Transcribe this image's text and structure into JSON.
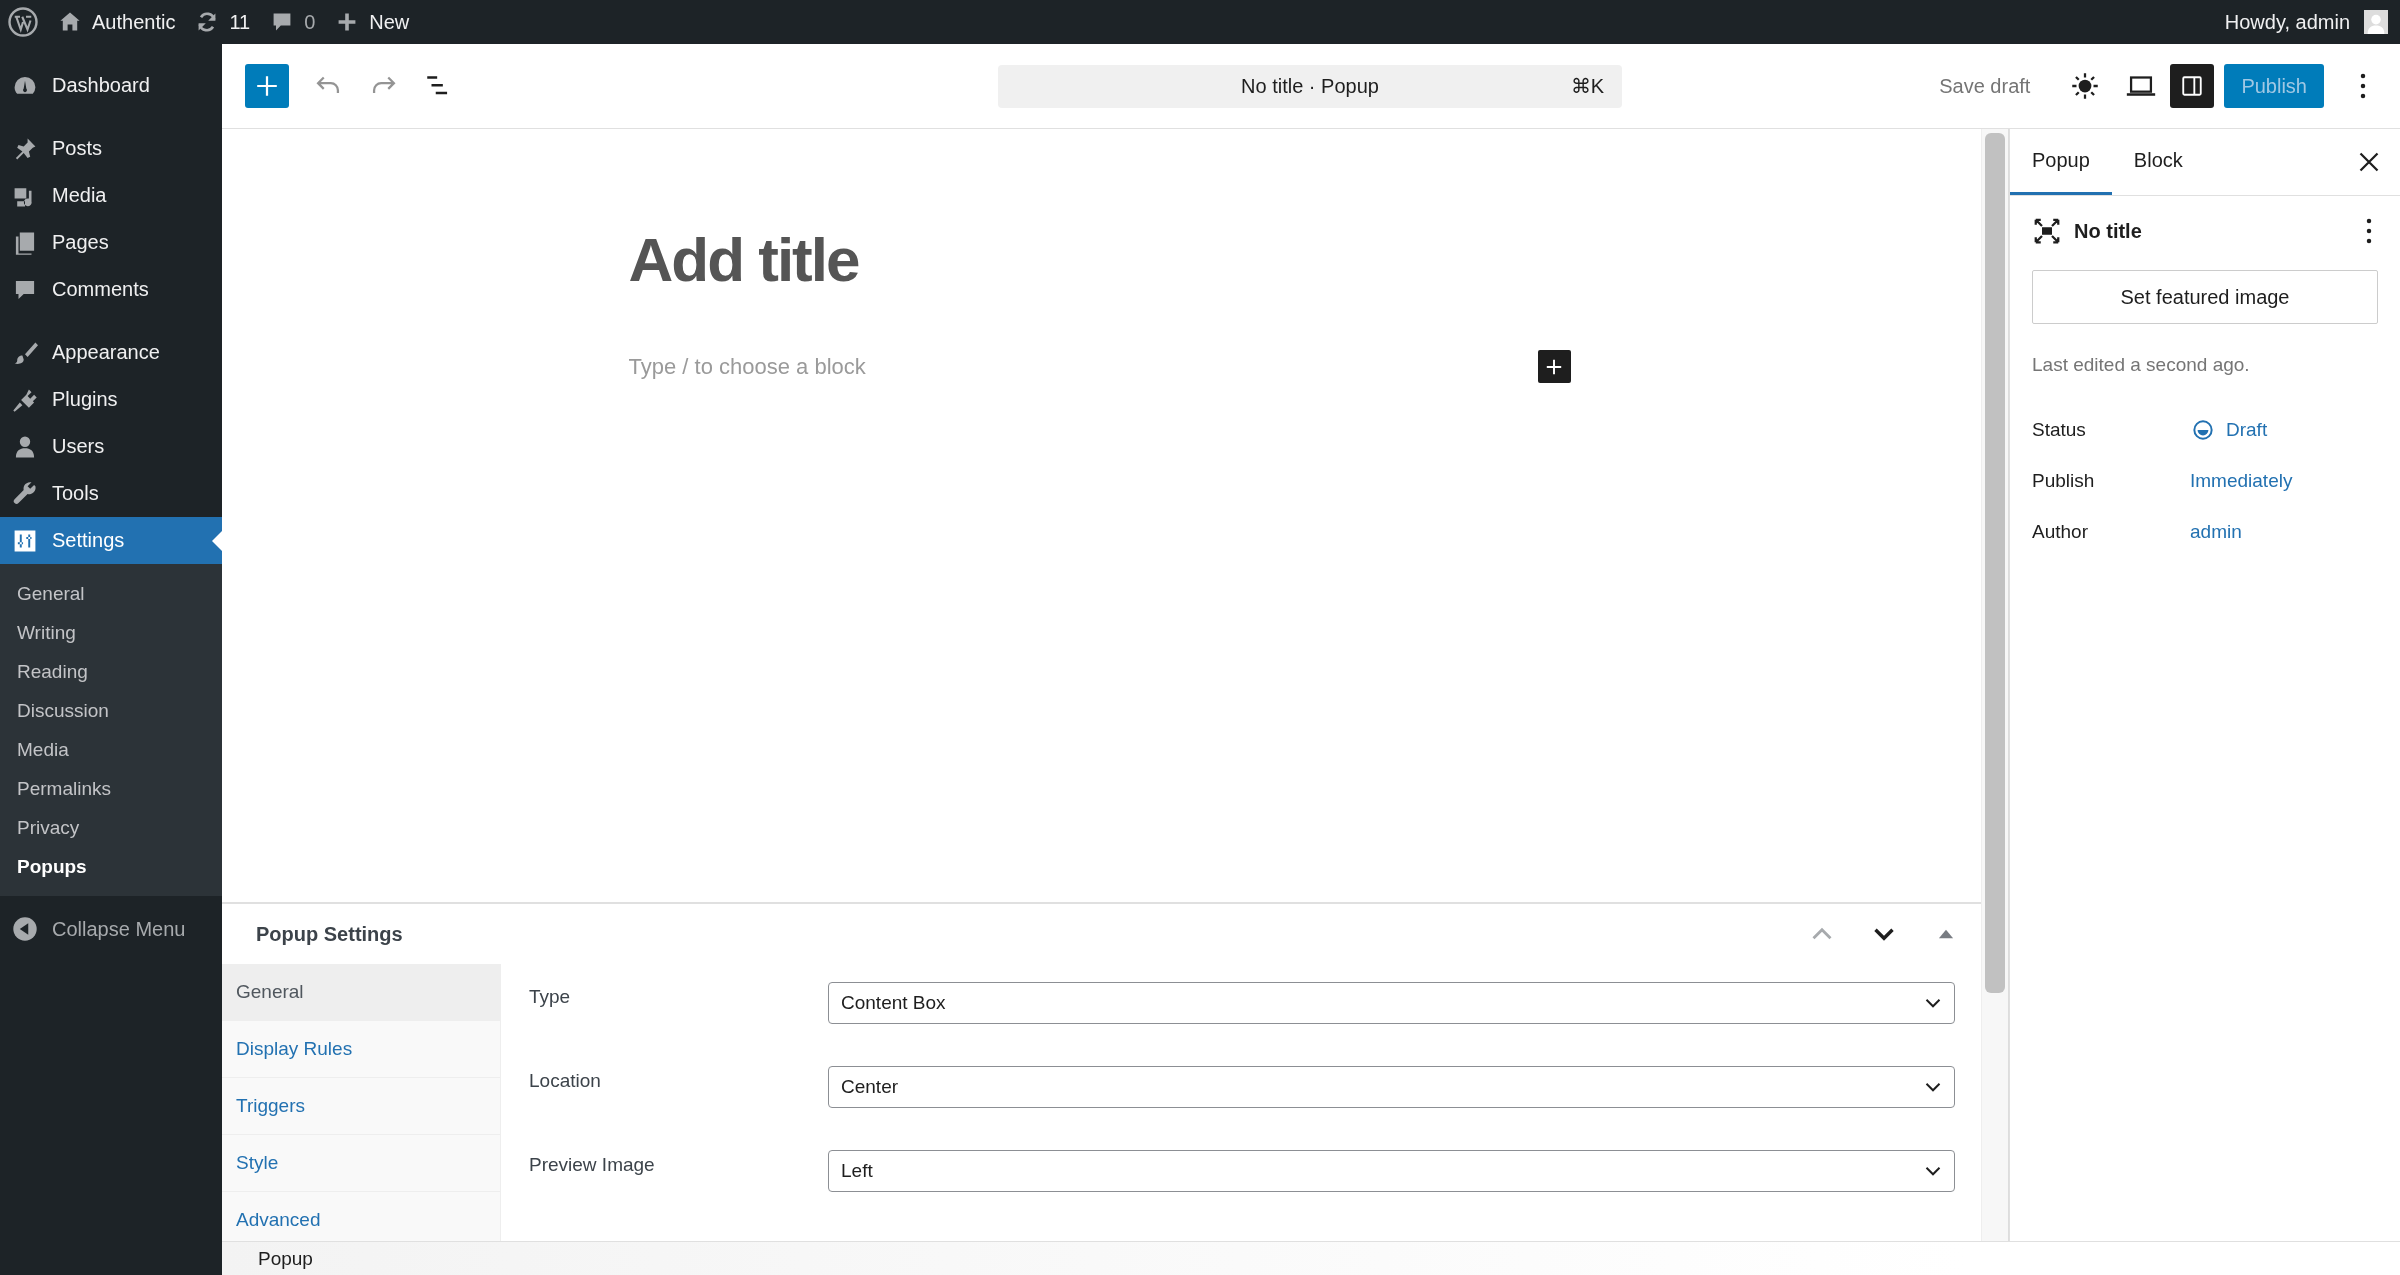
{
  "admin_bar": {
    "site": "Authentic",
    "updates": "11",
    "comments": "0",
    "new": "New",
    "greeting": "Howdy, admin"
  },
  "sidebar": {
    "groups": [
      {
        "items": [
          {
            "label": "Dashboard",
            "selected": false
          }
        ]
      },
      {
        "items": [
          {
            "label": "Posts",
            "selected": false
          },
          {
            "label": "Media",
            "selected": false
          },
          {
            "label": "Pages",
            "selected": false
          },
          {
            "label": "Comments",
            "selected": false
          }
        ]
      },
      {
        "items": [
          {
            "label": "Appearance",
            "selected": false
          },
          {
            "label": "Plugins",
            "selected": false
          },
          {
            "label": "Users",
            "selected": false
          },
          {
            "label": "Tools",
            "selected": false
          },
          {
            "label": "Settings",
            "selected": true,
            "children": [
              {
                "label": "General",
                "selected": false
              },
              {
                "label": "Writing",
                "selected": false
              },
              {
                "label": "Reading",
                "selected": false
              },
              {
                "label": "Discussion",
                "selected": false
              },
              {
                "label": "Media",
                "selected": false
              },
              {
                "label": "Permalinks",
                "selected": false
              },
              {
                "label": "Privacy",
                "selected": false
              },
              {
                "label": "Popups",
                "selected": true
              }
            ]
          }
        ]
      }
    ],
    "collapse": "Collapse Menu"
  },
  "toolbar": {
    "undo_disabled": true,
    "redo_disabled": true,
    "command": "No title · Popup",
    "shortcut": "⌘K",
    "save_draft": "Save draft",
    "sidebar_toggle_pressed": true,
    "publish": "Publish",
    "publish_disabled": true
  },
  "editor": {
    "title_placeholder": "Add title",
    "block_placeholder": "Type / to choose a block"
  },
  "meta_box": {
    "title": "Popup Settings",
    "tabs": [
      {
        "label": "General",
        "selected": true
      },
      {
        "label": "Display Rules",
        "selected": false
      },
      {
        "label": "Triggers",
        "selected": false
      },
      {
        "label": "Style",
        "selected": false
      },
      {
        "label": "Advanced",
        "selected": false
      }
    ],
    "fields": [
      {
        "label": "Type",
        "value": "Content Box"
      },
      {
        "label": "Location",
        "value": "Center"
      },
      {
        "label": "Preview Image",
        "value": "Left"
      }
    ]
  },
  "inspector": {
    "tabs": [
      {
        "label": "Popup",
        "selected": true
      },
      {
        "label": "Block",
        "selected": false
      }
    ],
    "post_title": "No title",
    "featured_button": "Set featured image",
    "last_edited": "Last edited a second ago.",
    "rows": [
      {
        "label": "Status",
        "value": "Draft",
        "kind": "status"
      },
      {
        "label": "Publish",
        "value": "Immediately",
        "kind": "link"
      },
      {
        "label": "Author",
        "value": "admin",
        "kind": "link"
      }
    ]
  },
  "footer": {
    "breadcrumb": "Popup"
  }
}
